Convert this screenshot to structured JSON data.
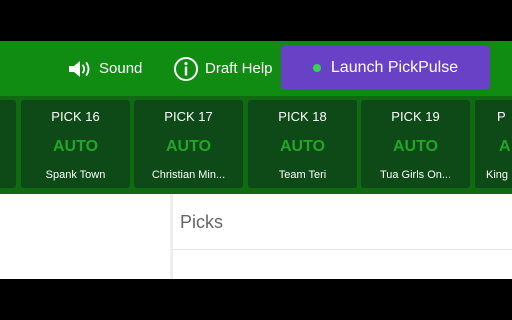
{
  "header": {
    "sound_label": "Sound",
    "help_label": "Draft Help",
    "launch_label": "Launch PickPulse",
    "colors": {
      "bar": "#108c12",
      "launch": "#6941c6",
      "launch_dot": "#39d353"
    }
  },
  "picks": [
    {
      "label": "",
      "auto": "",
      "team": ""
    },
    {
      "label": "PICK 16",
      "auto": "AUTO",
      "team": "Spank Town"
    },
    {
      "label": "PICK 17",
      "auto": "AUTO",
      "team": "Christian Min..."
    },
    {
      "label": "PICK 18",
      "auto": "AUTO",
      "team": "Team Teri"
    },
    {
      "label": "PICK 19",
      "auto": "AUTO",
      "team": "Tua Girls On..."
    },
    {
      "label": "P",
      "auto": "A",
      "team": "King"
    }
  ],
  "picks_panel": {
    "title": "Picks"
  }
}
